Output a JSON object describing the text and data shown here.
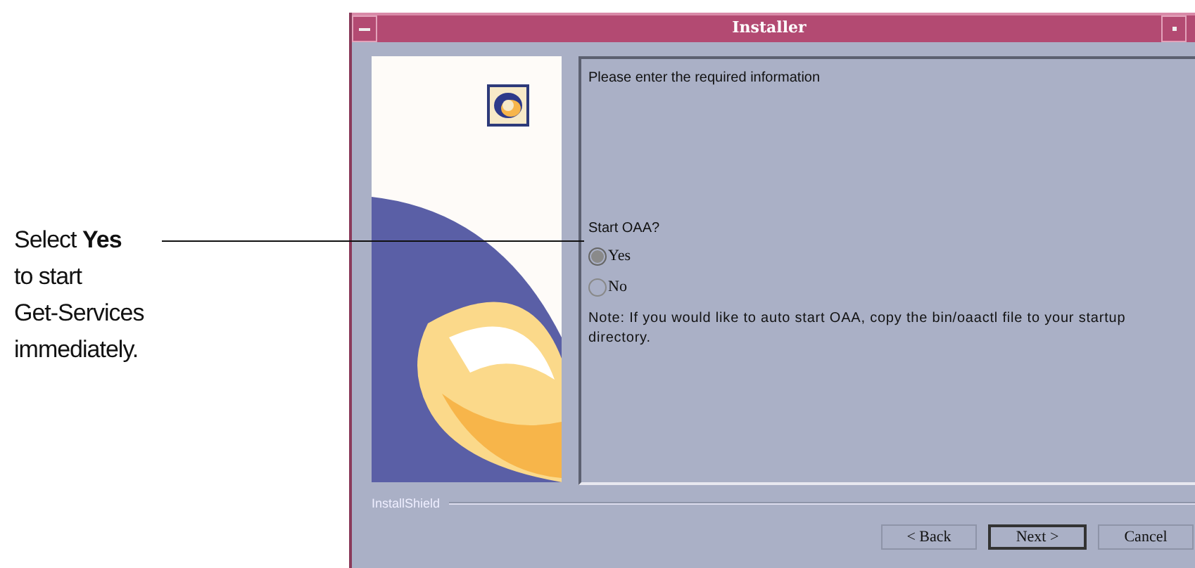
{
  "annotation": {
    "lines": [
      "Select **Yes**",
      "to start",
      "Get-Services",
      "immediately."
    ]
  },
  "window": {
    "title": "Installer"
  },
  "content": {
    "heading": "Please enter the required information",
    "question": "Start OAA?",
    "options": [
      {
        "label": "Yes",
        "selected": true
      },
      {
        "label": "No",
        "selected": false
      }
    ],
    "note": "Note:  If you would like to auto start OAA, copy the bin/oaactl file to your startup directory."
  },
  "footer": {
    "brand": "InstallShield"
  },
  "buttons": [
    {
      "label": "< Back",
      "default": false
    },
    {
      "label": "Next >",
      "default": true
    },
    {
      "label": "Cancel",
      "default": false
    }
  ]
}
